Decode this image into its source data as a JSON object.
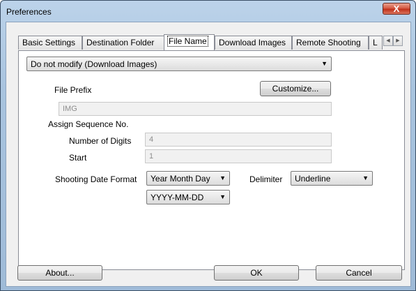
{
  "window": {
    "title": "Preferences",
    "close_glyph": "X"
  },
  "tabs": [
    {
      "label": "Basic Settings"
    },
    {
      "label": "Destination Folder"
    },
    {
      "label": "File Name"
    },
    {
      "label": "Download Images"
    },
    {
      "label": "Remote Shooting"
    },
    {
      "label": "L"
    }
  ],
  "active_tab": "File Name",
  "tab_scroll": {
    "left": "◀",
    "right": "▶"
  },
  "file_name": {
    "mode_value": "Do not modify (Download Images)",
    "file_prefix_label": "File Prefix",
    "customize_label": "Customize...",
    "prefix_value": "IMG",
    "assign_sequence_label": "Assign Sequence No.",
    "digits_label": "Number of Digits",
    "digits_value": "4",
    "start_label": "Start",
    "start_value": "1",
    "date_format_label": "Shooting Date Format",
    "date_format_value": "Year Month Day",
    "date_pattern_value": "YYYY-MM-DD",
    "delimiter_label": "Delimiter",
    "delimiter_value": "Underline"
  },
  "footer": {
    "about": "About...",
    "ok": "OK",
    "cancel": "Cancel"
  },
  "icons": {
    "dropdown": "chevron-down-icon",
    "close": "close-icon"
  }
}
